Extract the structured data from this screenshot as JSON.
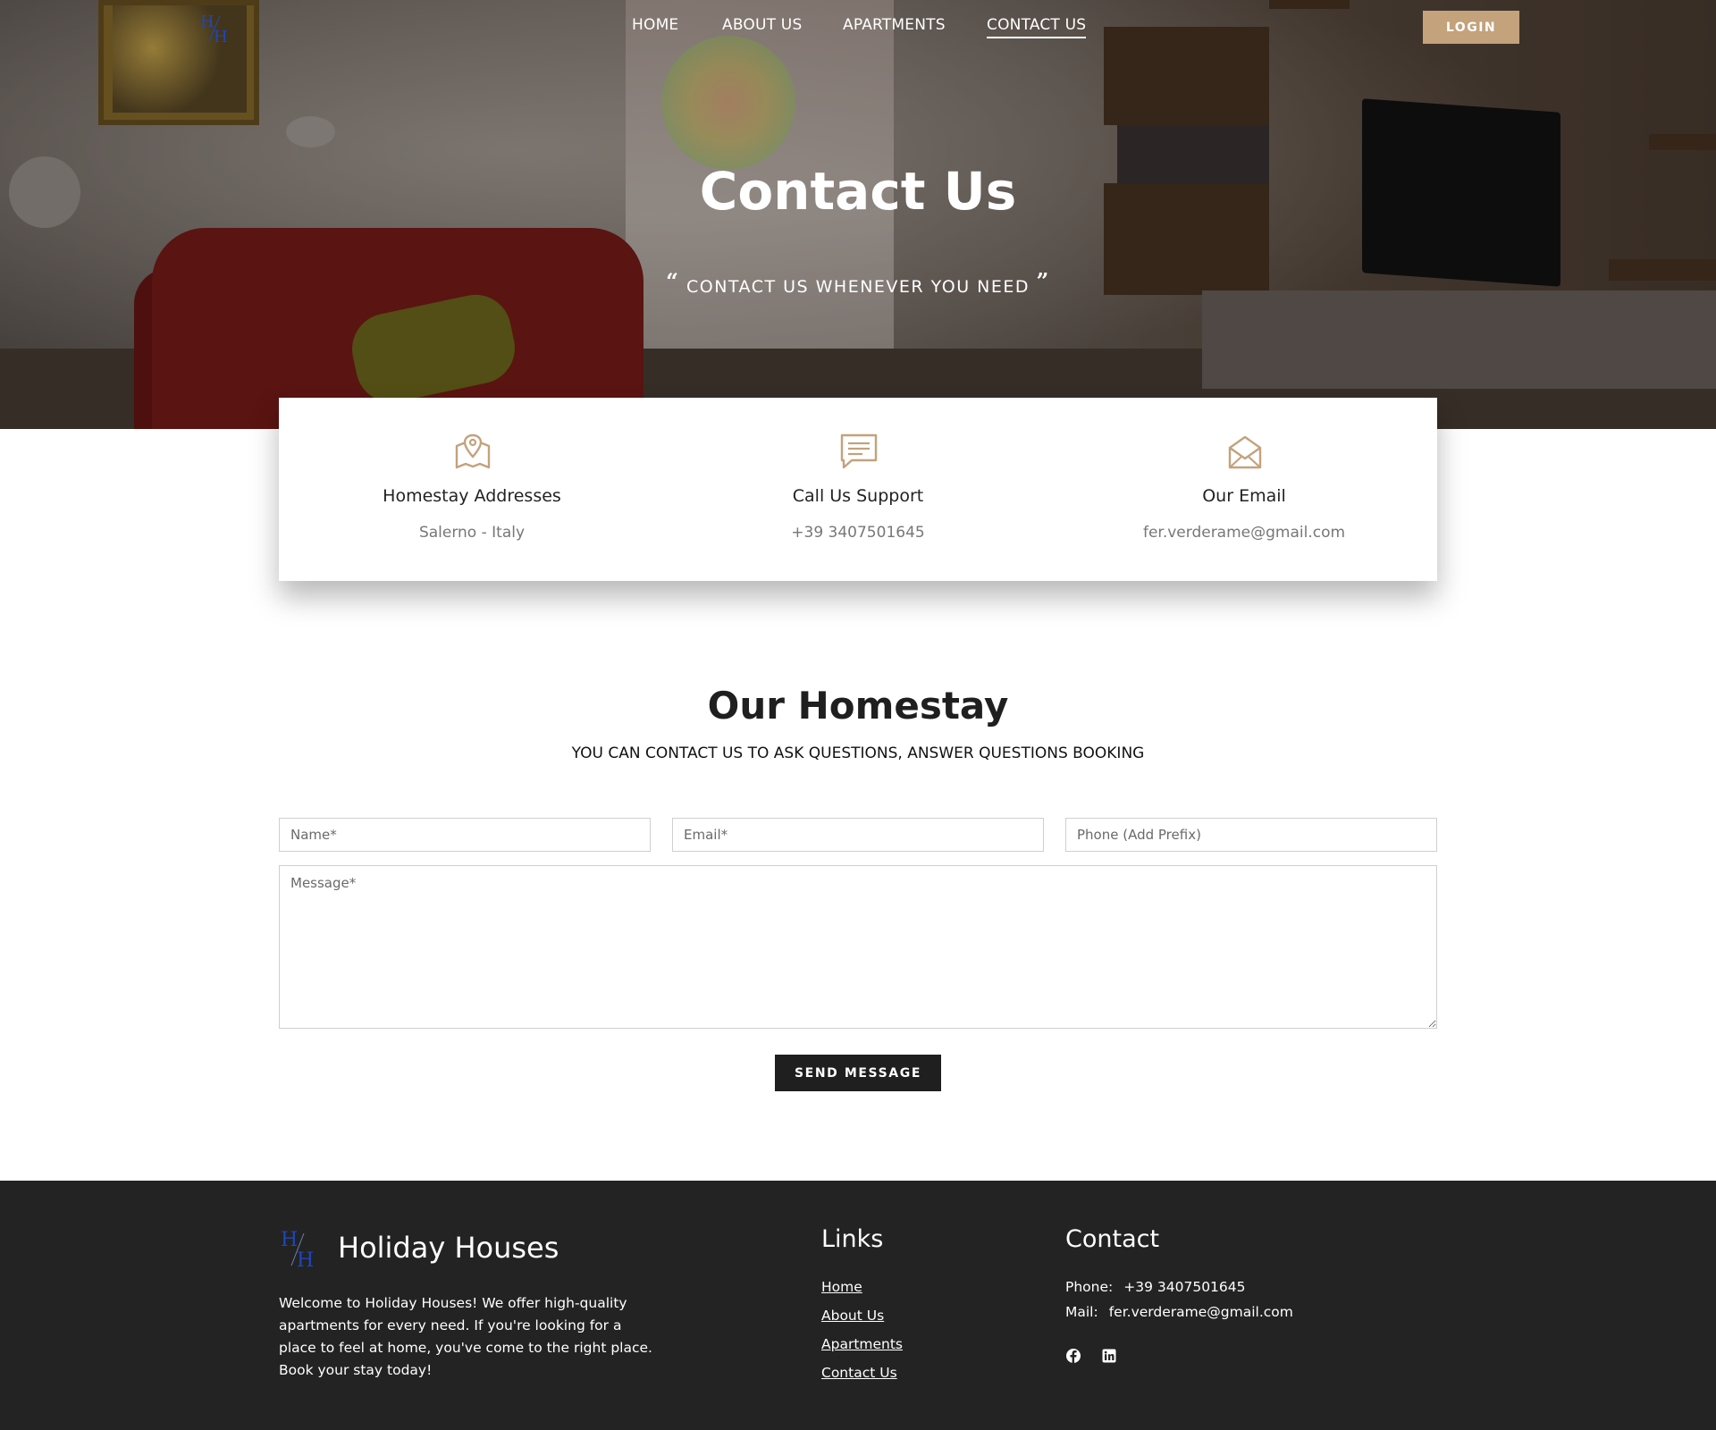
{
  "nav": {
    "items": [
      {
        "label": "HOME"
      },
      {
        "label": "ABOUT US"
      },
      {
        "label": "APARTMENTS"
      },
      {
        "label": "CONTACT US"
      }
    ],
    "login_label": "LOGIN",
    "logo_letters": "HH"
  },
  "hero": {
    "title": "Contact Us",
    "subtitle": "CONTACT US WHENEVER YOU NEED",
    "open_quote": "“",
    "close_quote": "”"
  },
  "info": [
    {
      "title": "Homestay Addresses",
      "value": "Salerno - Italy",
      "icon": "map-pin-icon"
    },
    {
      "title": "Call Us Support",
      "value": "+39 3407501645",
      "icon": "chat-bubble-icon"
    },
    {
      "title": "Our Email",
      "value": "fer.verderame@gmail.com",
      "icon": "envelope-open-icon"
    }
  ],
  "section": {
    "title": "Our Homestay",
    "subtitle": "YOU CAN CONTACT US TO ASK QUESTIONS, ANSWER QUESTIONS BOOKING"
  },
  "form": {
    "name_placeholder": "Name*",
    "email_placeholder": "Email*",
    "phone_placeholder": "Phone (Add Prefix)",
    "message_placeholder": "Message*",
    "send_label": "SEND MESSAGE"
  },
  "footer": {
    "brand": "Holiday Houses",
    "about": "Welcome to Holiday Houses! We offer high-quality apartments for every need. If you're looking for a place to feel at home, you've come to the right place. Book your stay today!",
    "links_title": "Links",
    "links": [
      {
        "label": "Home"
      },
      {
        "label": "About Us"
      },
      {
        "label": "Apartments"
      },
      {
        "label": "Contact Us"
      }
    ],
    "contact_title": "Contact",
    "phone_label": "Phone:",
    "phone": "+39 3407501645",
    "mail_label": "Mail:",
    "mail": "fer.verderame@gmail.com",
    "social": [
      "facebook-icon",
      "linkedin-icon"
    ]
  },
  "colors": {
    "accent": "#c3a27c",
    "dark": "#1f1f1f",
    "footer_bg": "#232323",
    "logo_blue": "#1f47b8"
  }
}
